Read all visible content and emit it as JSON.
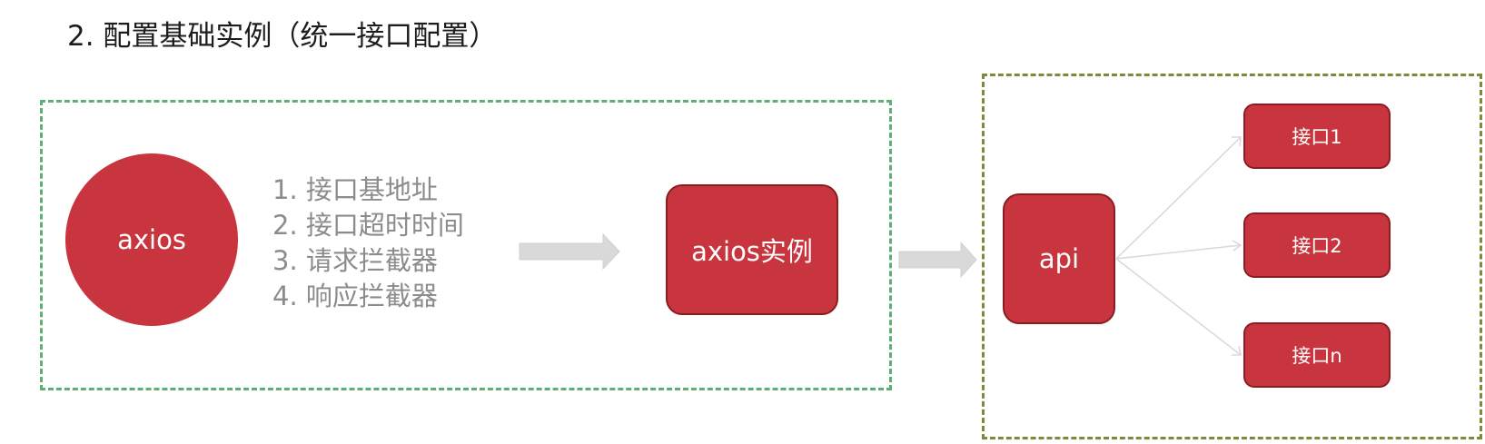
{
  "title": "2. 配置基础实例（统一接口配置）",
  "axios_node": {
    "label": "axios"
  },
  "config_items": [
    "1. 接口基地址",
    "2. 接口超时时间",
    "3. 请求拦截器",
    "4. 响应拦截器"
  ],
  "instance_node": {
    "label": "axios实例"
  },
  "api_node": {
    "label": "api"
  },
  "endpoints": [
    {
      "label": "接口1"
    },
    {
      "label": "接口2"
    },
    {
      "label": "接口n"
    }
  ],
  "colors": {
    "node_fill": "#c9353e",
    "node_border": "#8a1d24",
    "config_group_border": "#5fae74",
    "api_group_border": "#7c8a3e",
    "list_text": "#8c8c8c",
    "arrow_fill": "#d9d9d9"
  }
}
